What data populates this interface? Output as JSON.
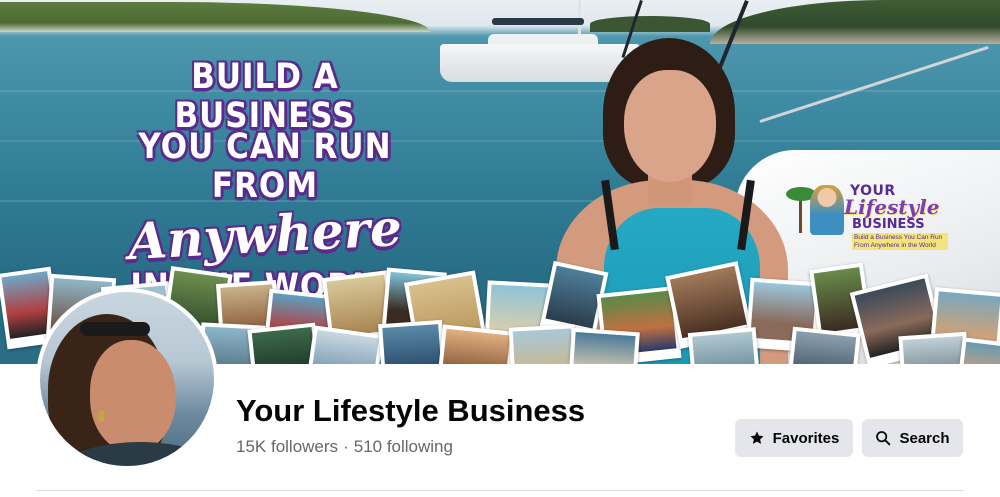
{
  "cover": {
    "headline_line1": "BUILD A BUSINESS",
    "headline_line2": "YOU CAN RUN FROM",
    "headline_script": "Anywhere",
    "headline_line4": "IN THE WORLD",
    "logo_line1": "YOUR",
    "logo_line2": "Lifestyle",
    "logo_line3": "BUSINESS",
    "logo_tagline": "Build a Business You Can Run From Anywhere in the World"
  },
  "profile": {
    "page_name": "Your Lifestyle Business",
    "followers": "15K followers",
    "separator": "·",
    "following": "510 following"
  },
  "actions": {
    "favorites_label": "Favorites",
    "search_label": "Search"
  },
  "icons": {
    "favorites": "star-icon",
    "search": "search-icon"
  },
  "colors": {
    "button_bg": "#e4e6eb",
    "title_text": "#050505",
    "secondary_text": "#65676b",
    "headline_outline": "#5a2a8c"
  }
}
